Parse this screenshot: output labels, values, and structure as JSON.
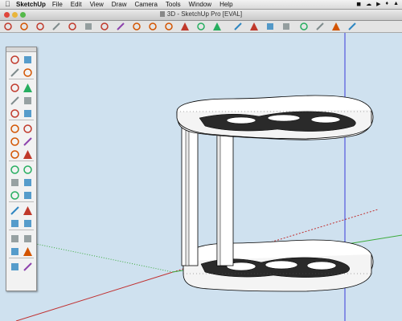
{
  "menubar": {
    "app_name": "SketchUp",
    "items": [
      "File",
      "Edit",
      "View",
      "Draw",
      "Camera",
      "Tools",
      "Window",
      "Help"
    ]
  },
  "window": {
    "title": "3D - SketchUp Pro [EVAL]"
  },
  "toolbar": {
    "icons": [
      "select-icon",
      "eraser-icon",
      "rectangle-icon",
      "circle-icon",
      "polygon-icon",
      "arc-icon",
      "push-pull-icon",
      "follow-me-icon",
      "move-icon",
      "rotate-icon",
      "scale-icon",
      "offset-icon",
      "tape-measure-icon",
      "paint-bucket-icon",
      "orbit-icon",
      "pan-icon",
      "zoom-icon",
      "zoom-extents-icon",
      "components-icon",
      "warehouse-icon",
      "share-icon",
      "extensions-icon"
    ]
  },
  "palette": {
    "icons": [
      "select-icon",
      "component-icon",
      "paint-icon",
      "eraser-icon",
      "rectangle-icon",
      "line-icon",
      "circle-icon",
      "arc-icon",
      "polygon-icon",
      "freehand-icon",
      "move-icon",
      "push-pull-icon",
      "rotate-icon",
      "follow-me-icon",
      "scale-icon",
      "offset-icon",
      "tape-measure-icon",
      "dimension-icon",
      "protractor-icon",
      "text-icon",
      "axes-icon",
      "3d-text-icon",
      "orbit-icon",
      "pan-icon",
      "zoom-icon",
      "zoom-window-icon",
      "zoom-extents-icon",
      "previous-icon",
      "position-camera-icon",
      "walk-icon",
      "look-around-icon",
      "section-plane-icon"
    ]
  },
  "colors": {
    "viewport_bg": "#cfe1ef",
    "axis_blue": "#3a3ad8",
    "axis_red": "#c03030",
    "axis_green": "#3cab3c"
  }
}
